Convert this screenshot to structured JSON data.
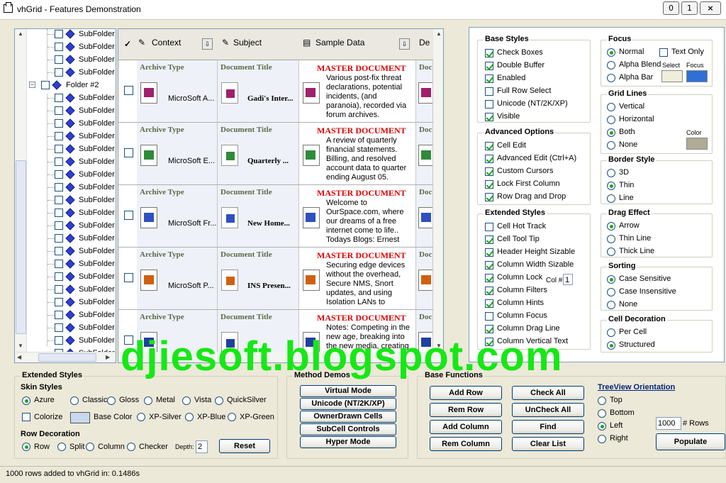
{
  "window": {
    "title": "vhGrid - Features Demonstration",
    "minimize": "0",
    "maximize": "1",
    "close": "×"
  },
  "tree": {
    "folder2": "Folder #2",
    "subfolder": "SubFolder"
  },
  "grid": {
    "columns": [
      {
        "label": "Context"
      },
      {
        "label": "Subject"
      },
      {
        "label": "Sample Data"
      },
      {
        "label": "De"
      }
    ],
    "check_header": "✓",
    "rows": [
      {
        "archive_label": "Archive Type",
        "archive_value": "MicroSoft A...",
        "title_label": "Document Title",
        "title_value": "Gadi's Inter...",
        "sample_label": "MASTER DOCUMENT",
        "sample_text": "Various post-fix threat declarations, potential incidents, (and paranoia), recorded via forum archives.",
        "cut_label": "Docum",
        "icon_color": "#a0206a"
      },
      {
        "archive_label": "Archive Type",
        "archive_value": "MicroSoft E...",
        "title_label": "Document Title",
        "title_value": "Quarterly ...",
        "sample_label": "MASTER DOCUMENT",
        "sample_text": "A review of quarterly financial statements. Billing, and resolved account data to quarter ending August 05.",
        "cut_label": "Docum",
        "icon_color": "#2e8b3a"
      },
      {
        "archive_label": "Archive Type",
        "archive_value": "MicroSoft Fr...",
        "title_label": "Document Title",
        "title_value": "New Home...",
        "sample_label": "MASTER DOCUMENT",
        "sample_text": "Welcome to OurSpace.com, where our dreams of a free internet come to life.. Todays Blogs: Ernest",
        "cut_label": "Docum",
        "icon_color": "#3050c0"
      },
      {
        "archive_label": "Archive Type",
        "archive_value": "MicroSoft P...",
        "title_label": "Document Title",
        "title_value": "INS Presen...",
        "sample_label": "MASTER DOCUMENT",
        "sample_text": "Securing edge devices without the overhead, Secure NMS, Snort updates, and using Isolation LANs to",
        "cut_label": "Docum",
        "icon_color": "#d06010"
      },
      {
        "archive_label": "Archive Type",
        "archive_value": "",
        "title_label": "Document Title",
        "title_value": "",
        "sample_label": "MASTER DOCUMENT",
        "sample_text": "Notes: Competing in the new age, breaking into the new media, creating",
        "cut_label": "Docum",
        "icon_color": "#2040a0"
      }
    ]
  },
  "base_styles": {
    "title": "Base Styles",
    "items": [
      {
        "label": "Check Boxes",
        "on": true
      },
      {
        "label": "Double Buffer",
        "on": true
      },
      {
        "label": "Enabled",
        "on": true
      },
      {
        "label": "Full Row Select",
        "on": false
      },
      {
        "label": "Unicode (NT/2K/XP)",
        "on": false
      },
      {
        "label": "Visible",
        "on": true
      }
    ]
  },
  "advanced_options": {
    "title": "Advanced Options",
    "items": [
      {
        "label": "Cell Edit",
        "on": true
      },
      {
        "label": "Advanced Edit (Ctrl+A)",
        "on": true
      },
      {
        "label": "Custom Cursors",
        "on": true
      },
      {
        "label": "Lock First Column",
        "on": true
      },
      {
        "label": "Row Drag and Drop",
        "on": true
      }
    ]
  },
  "extended_styles": {
    "title": "Extended Styles",
    "items": [
      {
        "label": "Cell Hot Track",
        "on": false
      },
      {
        "label": "Cell Tool Tip",
        "on": true
      },
      {
        "label": "Header Height Sizable",
        "on": true
      },
      {
        "label": "Column Width Sizable",
        "on": true
      },
      {
        "label": "Column Lock",
        "on": true
      },
      {
        "label": "Column Filters",
        "on": true
      },
      {
        "label": "Column Hints",
        "on": true
      },
      {
        "label": "Column Focus",
        "on": false
      },
      {
        "label": "Column Drag Line",
        "on": true
      },
      {
        "label": "Column Vertical Text",
        "on": true
      }
    ],
    "col_label": "Col #",
    "col_value": "1"
  },
  "focus": {
    "title": "Focus",
    "normal": "Normal",
    "alpha_blend": "Alpha Blend",
    "alpha_bar": "Alpha Bar",
    "text_only": "Text Only",
    "select": "Select",
    "focus": "Focus",
    "select_color": "#efeedc",
    "focus_color": "#2f6fd7"
  },
  "grid_lines": {
    "title": "Grid Lines",
    "options": [
      "Vertical",
      "Horizontal",
      "Both",
      "None"
    ],
    "selected": "Both",
    "color_label": "Color",
    "color": "#b0ab95"
  },
  "border_style": {
    "title": "Border Style",
    "options": [
      "3D",
      "Thin",
      "Line"
    ],
    "selected": "Thin"
  },
  "drag_effect": {
    "title": "Drag Effect",
    "options": [
      "Arrow",
      "Thin Line",
      "Thick Line"
    ],
    "selected": "Arrow"
  },
  "sorting": {
    "title": "Sorting",
    "options": [
      "Case Sensitive",
      "Case Insensitive",
      "None"
    ],
    "selected": "Case Sensitive"
  },
  "cell_decoration": {
    "title": "Cell Decoration",
    "options": [
      "Per Cell",
      "Structured"
    ],
    "selected": "Structured"
  },
  "bottom_ext": {
    "title": "Extended Styles",
    "skin_title": "Skin Styles",
    "skins": [
      "Azure",
      "Classic",
      "Gloss",
      "Metal",
      "Vista",
      "QuickSilver"
    ],
    "selected_skin": "Azure",
    "colorize": "Colorize",
    "base_color": "Base Color",
    "xp": [
      "XP-Silver",
      "XP-Blue",
      "XP-Green"
    ],
    "row_deco_title": "Row Decoration",
    "row_deco": [
      "Row",
      "Split",
      "Column",
      "Checker"
    ],
    "row_deco_selected": "Row",
    "depth_label": "Depth:",
    "depth_value": "2",
    "reset": "Reset"
  },
  "method_demos": {
    "title": "Method Demos",
    "buttons": [
      "Virtual Mode",
      "Unicode (NT/2K/XP)",
      "OwnerDrawn Cells",
      "SubCell Controls",
      "Hyper Mode"
    ]
  },
  "base_functions": {
    "title": "Base Functions",
    "buttons": [
      "Add Row",
      "Check All",
      "Rem Row",
      "UnCheck All",
      "Add Column",
      "Find",
      "Rem Column",
      "Clear List"
    ]
  },
  "tree_orient": {
    "title": "TreeView Orientation",
    "options": [
      "Top",
      "Bottom",
      "Left",
      "Right"
    ],
    "selected": "Left",
    "rows_value": "1000",
    "rows_label": "# Rows",
    "populate": "Populate"
  },
  "status": {
    "text": "1000 rows added to vhGrid in: 0.1486s"
  },
  "watermark": "djiesoft.blogspot.com"
}
